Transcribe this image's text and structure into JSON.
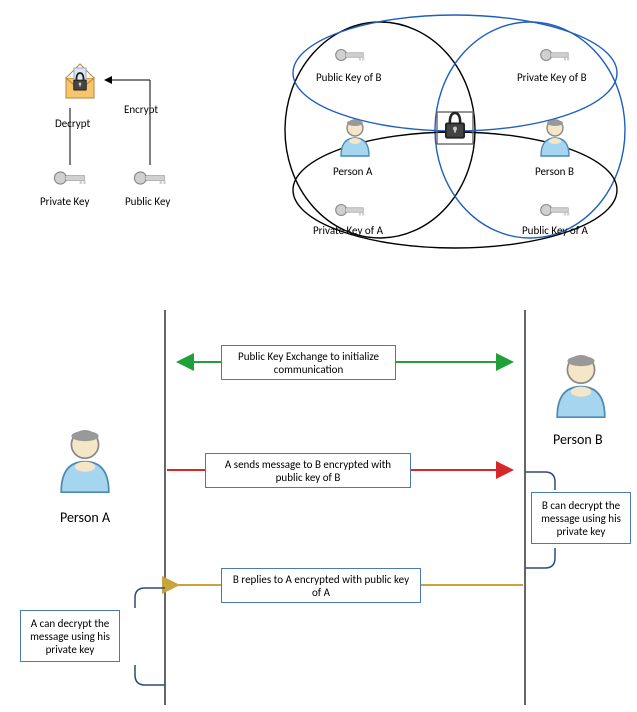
{
  "top_left": {
    "private_key": "Private Key",
    "public_key": "Public Key",
    "decrypt": "Decrypt",
    "encrypt": "Encrypt"
  },
  "venn": {
    "public_key_b": "Public Key of B",
    "private_key_b": "Private Key of B",
    "person_a": "Person A",
    "person_b": "Person B",
    "private_key_a": "Private Key of A",
    "public_key_a": "Public Key of A"
  },
  "seq": {
    "person_a": "Person A",
    "person_b": "Person B",
    "step1": "Public Key Exchange to initialize communication",
    "step2": "A sends message to B encrypted with public key of B",
    "step2_note": "B can decrypt the message using his private key",
    "step3": "B replies to A encrypted with public key of A",
    "step3_note": "A can decrypt the message using his private key"
  }
}
